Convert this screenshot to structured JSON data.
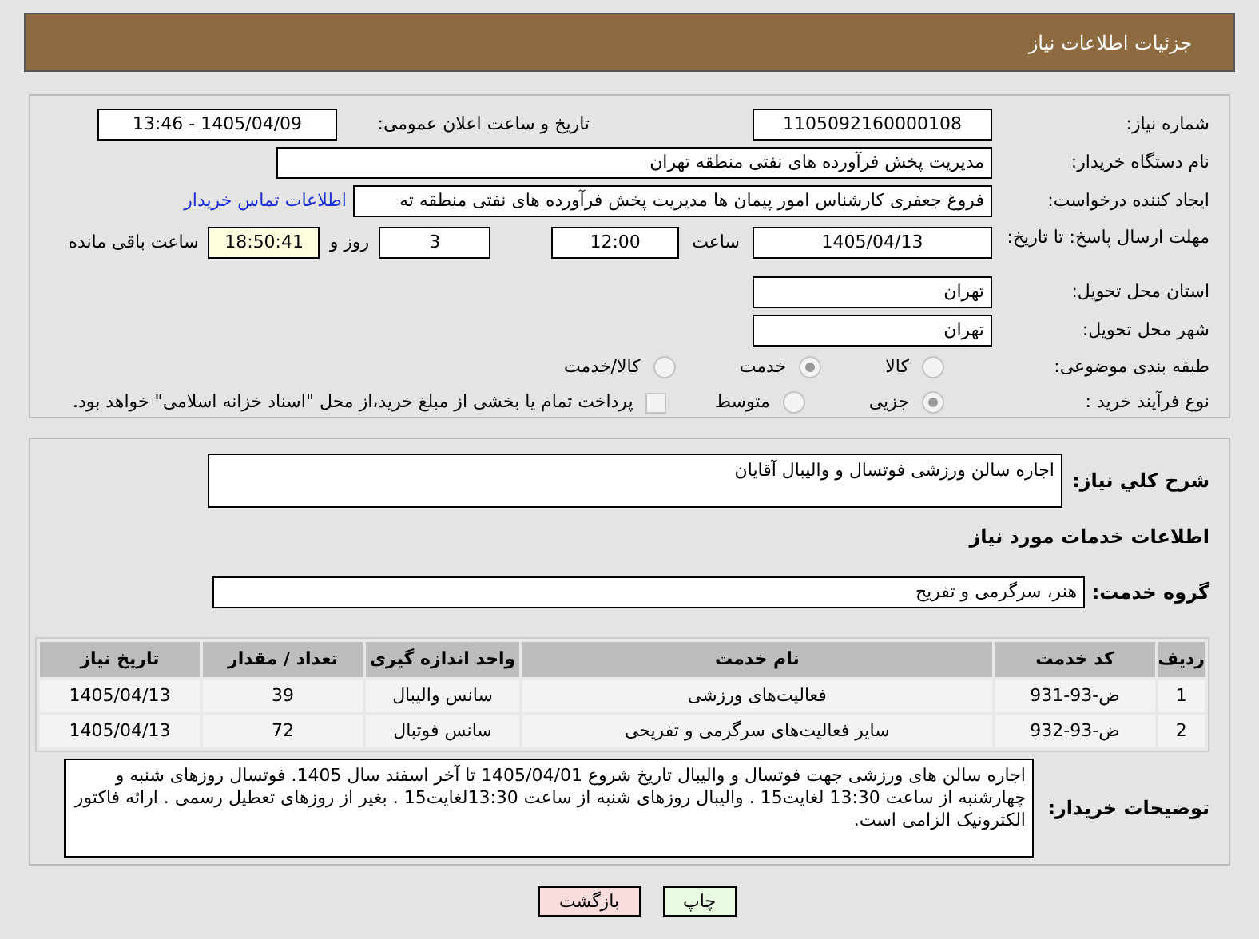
{
  "header": {
    "title": "جزئیات اطلاعات نیاز"
  },
  "need_number": {
    "label": "شماره نیاز:",
    "value": "1105092160000108"
  },
  "announce": {
    "label": "تاریخ و ساعت اعلان عمومی:",
    "value": "1405/04/09 - 13:46"
  },
  "buyer_org": {
    "label": "نام دستگاه خریدار:",
    "value": "مدیریت پخش فرآورده های نفتی منطقه تهران"
  },
  "creator": {
    "label": "ایجاد کننده درخواست:",
    "value": "فروغ جعفری کارشناس امور پیمان ها مدیریت پخش فرآورده های نفتی منطقه ته",
    "link": "اطلاعات تماس خریدار"
  },
  "deadline": {
    "label": "مهلت ارسال پاسخ: تا تاریخ:",
    "date": "1405/04/13",
    "time_label": "ساعت",
    "time": "12:00",
    "days": "3",
    "days_label": "روز و",
    "remaining": "18:50:41",
    "remaining_label": "ساعت باقی مانده"
  },
  "province": {
    "label": "استان محل تحویل:",
    "value": "تهران"
  },
  "city": {
    "label": "شهر محل تحویل:",
    "value": "تهران"
  },
  "category": {
    "label": "طبقه بندی موضوعی:",
    "options": [
      {
        "label": "کالا",
        "selected": false
      },
      {
        "label": "خدمت",
        "selected": true
      },
      {
        "label": "کالا/خدمت",
        "selected": false
      }
    ]
  },
  "process": {
    "label": "نوع فرآیند خرید :",
    "options": [
      {
        "label": "جزیی",
        "selected": true
      },
      {
        "label": "متوسط",
        "selected": false
      }
    ],
    "payment": {
      "label": "پرداخت تمام یا بخشی از مبلغ خرید،از محل \"اسناد خزانه اسلامی\" خواهد بود.",
      "checked": false
    }
  },
  "description": {
    "label": "شرح کلي نیاز:",
    "value": "اجاره سالن ورزشی فوتسال و والیبال آقایان"
  },
  "services_title": "اطلاعات خدمات مورد نیاز",
  "service_group": {
    "label": "گروه خدمت:",
    "value": "هنر، سرگرمی و تفریح"
  },
  "table": {
    "columns": [
      "ردیف",
      "کد خدمت",
      "نام خدمت",
      "واحد اندازه گیری",
      "تعداد / مقدار",
      "تاریخ نیاز"
    ],
    "rows": [
      [
        "1",
        "ض-93-931",
        "فعالیت‌های ورزشی",
        "سانس والیبال",
        "39",
        "1405/04/13"
      ],
      [
        "2",
        "ض-93-932",
        "سایر فعالیت‌های سرگرمی و تفریحی",
        "سانس فوتبال",
        "72",
        "1405/04/13"
      ]
    ]
  },
  "notes": {
    "label": "توضیحات خریدار:",
    "value": "اجاره سالن های ورزشی جهت فوتسال و والیبال تاریخ شروع 1405/04/01 تا آخر اسفند سال 1405. فوتسال روزهای شنبه و چهارشنبه از ساعت 13:30 لغایت15 . والیبال روزهای شنبه از ساعت 13:30لغایت15 . بغیر از روزهای تعطیل رسمی . ارائه فاکتور الکترونیک الزامی است."
  },
  "buttons": [
    {
      "label": "چاپ",
      "kind": "print"
    },
    {
      "label": "بازگشت",
      "kind": "back"
    }
  ]
}
